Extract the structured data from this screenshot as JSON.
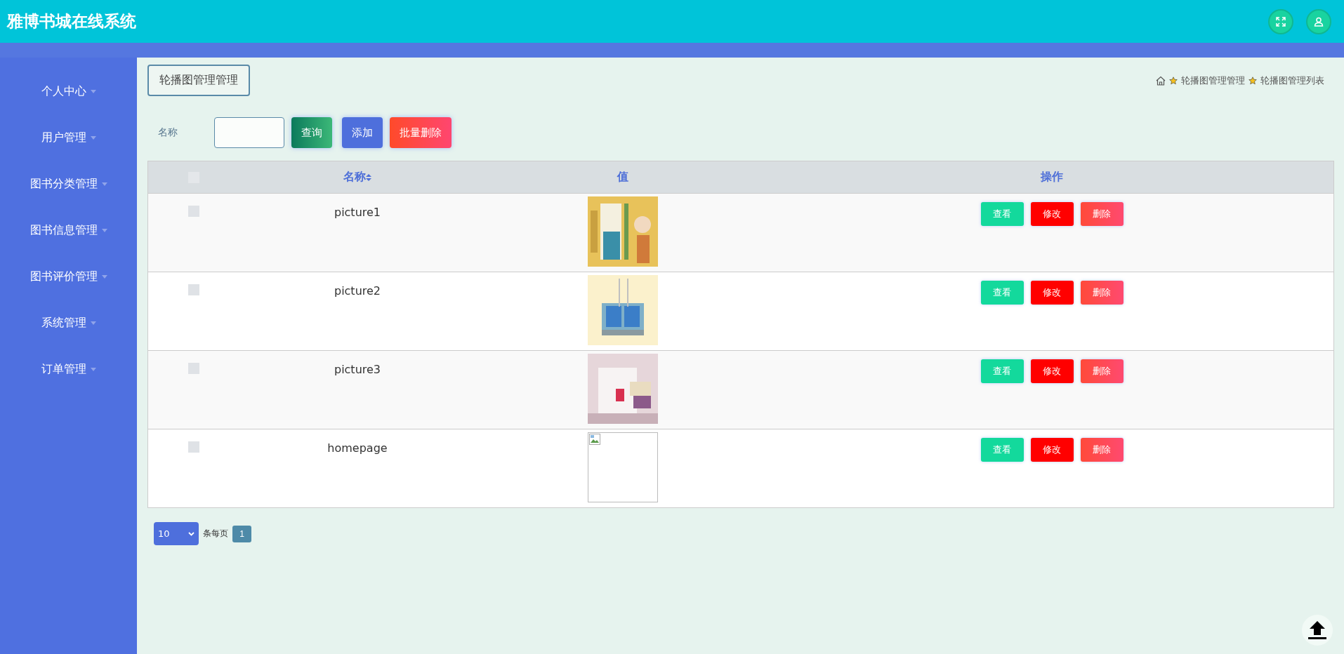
{
  "header": {
    "title": "雅博书城在线系统"
  },
  "sidebar": {
    "items": [
      {
        "label": "个人中心"
      },
      {
        "label": "用户管理"
      },
      {
        "label": "图书分类管理"
      },
      {
        "label": "图书信息管理"
      },
      {
        "label": "图书评价管理"
      },
      {
        "label": "系统管理"
      },
      {
        "label": "订单管理"
      }
    ]
  },
  "page_title": "轮播图管理管理",
  "breadcrumb": [
    "轮播图管理管理",
    "轮播图管理列表"
  ],
  "search": {
    "label": "名称",
    "buttons": [
      {
        "label": "查询",
        "kind": "query"
      },
      {
        "label": "添加",
        "kind": "add"
      },
      {
        "label": "批量删除",
        "kind": "delete"
      }
    ]
  },
  "table": {
    "header_checked": false,
    "columns": [
      "名称",
      "值",
      "操作"
    ],
    "rows": [
      {
        "checked": false,
        "name": "picture1",
        "image": {
          "kind": "picture"
        },
        "actions": [
          {
            "label": "查看",
            "kind": "view"
          },
          {
            "label": "修改",
            "kind": "edit"
          },
          {
            "label": "删除",
            "kind": "delete"
          }
        ]
      },
      {
        "checked": false,
        "name": "picture2",
        "image": {
          "kind": "picture"
        },
        "actions": [
          {
            "label": "查看",
            "kind": "view"
          },
          {
            "label": "修改",
            "kind": "edit"
          },
          {
            "label": "删除",
            "kind": "delete"
          }
        ]
      },
      {
        "checked": false,
        "name": "picture3",
        "image": {
          "kind": "picture"
        },
        "actions": [
          {
            "label": "查看",
            "kind": "view"
          },
          {
            "label": "修改",
            "kind": "edit"
          },
          {
            "label": "删除",
            "kind": "delete"
          }
        ]
      },
      {
        "checked": false,
        "name": "homepage",
        "image": {
          "kind": "broken"
        },
        "actions": [
          {
            "label": "查看",
            "kind": "view"
          },
          {
            "label": "修改",
            "kind": "edit"
          },
          {
            "label": "删除",
            "kind": "delete"
          }
        ]
      }
    ]
  },
  "pagination": {
    "page_size": "10",
    "per_page_label": "条每页",
    "pages": [
      {
        "label": "1",
        "selected": true
      }
    ]
  }
}
